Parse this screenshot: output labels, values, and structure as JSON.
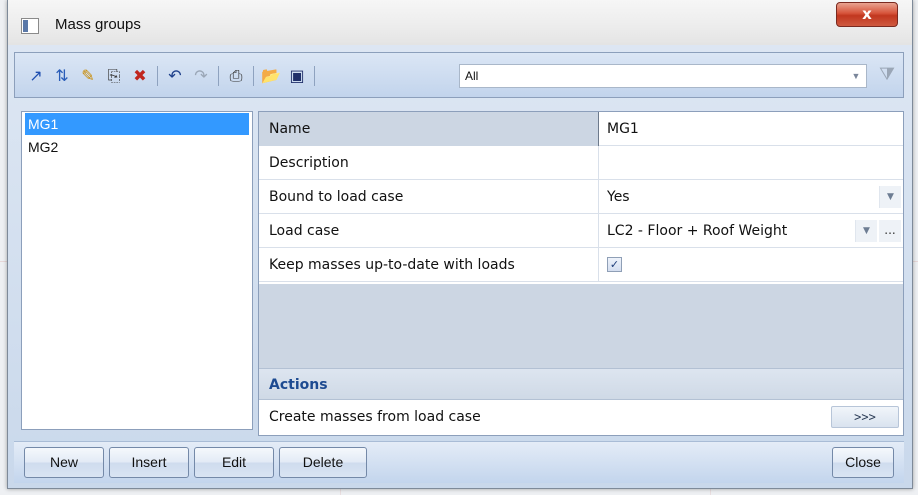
{
  "window": {
    "title": "Mass groups",
    "close_glyph": "x"
  },
  "toolbar": {
    "icons": [
      "new-entry-icon",
      "sort-icon",
      "edit-pencil-icon",
      "copy-icon",
      "delete-icon",
      "undo-icon",
      "redo-icon",
      "print-icon",
      "open-folder-icon",
      "save-icon",
      "filter-funnel-icon"
    ],
    "filter_value": "All"
  },
  "list": {
    "items": [
      "MG1",
      "MG2"
    ],
    "selected": "MG1"
  },
  "properties": {
    "rows": [
      {
        "label": "Name",
        "value": "MG1"
      },
      {
        "label": "Description",
        "value": ""
      },
      {
        "label": "Bound to load case",
        "value": "Yes"
      },
      {
        "label": "Load case",
        "value": "LC2 - Floor + Roof Weight"
      },
      {
        "label": "Keep masses up-to-date with loads",
        "value": "checked"
      }
    ],
    "actions_header": "Actions",
    "action_label": "Create masses from load case",
    "action_button": ">>>"
  },
  "buttons": {
    "new": "New",
    "insert": "Insert",
    "edit": "Edit",
    "delete": "Delete",
    "close": "Close"
  }
}
